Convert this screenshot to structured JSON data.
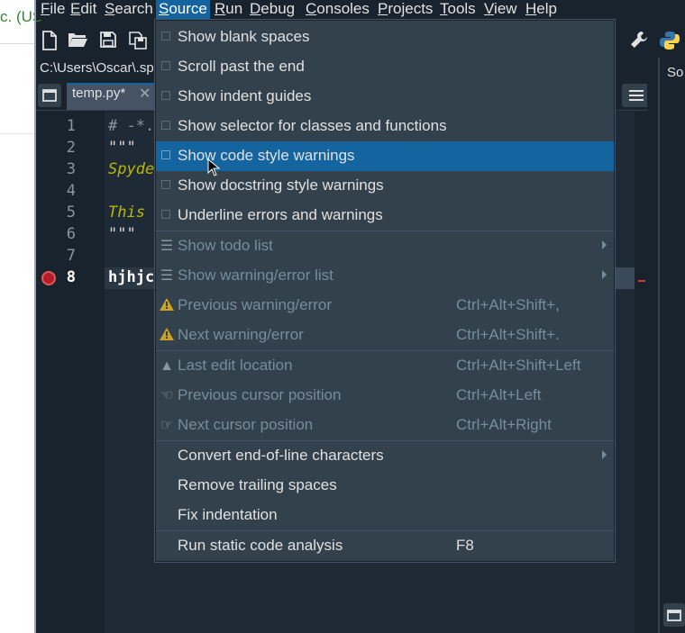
{
  "background_window": {
    "partial_text": "c. (US"
  },
  "menubar": {
    "items": [
      {
        "pre": "",
        "mn": "F",
        "post": "ile"
      },
      {
        "pre": "",
        "mn": "E",
        "post": "dit"
      },
      {
        "pre": "",
        "mn": "S",
        "post": "earch"
      },
      {
        "pre": "",
        "mn": "S",
        "post": "ource"
      },
      {
        "pre": "",
        "mn": "R",
        "post": "un"
      },
      {
        "pre": "",
        "mn": "D",
        "post": "ebug"
      },
      {
        "pre": "",
        "mn": "C",
        "post": "onsoles"
      },
      {
        "pre": "",
        "mn": "P",
        "post": "rojects"
      },
      {
        "pre": "",
        "mn": "T",
        "post": "ools"
      },
      {
        "pre": "",
        "mn": "V",
        "post": "iew"
      },
      {
        "pre": "",
        "mn": "H",
        "post": "elp"
      }
    ],
    "active": "Source"
  },
  "toolbar": {
    "icons": [
      "new-file-icon",
      "open-folder-icon",
      "save-icon",
      "save-all-icon",
      "wrench-icon",
      "python-icon"
    ]
  },
  "path": {
    "text": "C:\\Users\\Oscar\\.sp"
  },
  "tabs": [
    {
      "label": "temp.py*",
      "close": "✕"
    }
  ],
  "editor": {
    "line_numbers": [
      "1",
      "2",
      "3",
      "4",
      "5",
      "6",
      "7",
      "8"
    ],
    "lines": [
      "# -*.",
      "\"\"\"",
      "Spyde",
      "",
      "This",
      "\"\"\"",
      "",
      "hjhjc"
    ],
    "current_line": "8"
  },
  "right_pane": {
    "label": "So"
  },
  "source_menu": {
    "items": [
      {
        "label": "Show blank spaces",
        "type": "check"
      },
      {
        "label": "Scroll past the end",
        "type": "check"
      },
      {
        "label": "Show indent guides",
        "type": "check"
      },
      {
        "label": "Show selector for classes and functions",
        "type": "check"
      },
      {
        "label": "Show code style warnings",
        "type": "check",
        "highlighted": true
      },
      {
        "label": "Show docstring style warnings",
        "type": "check"
      },
      {
        "label": "Underline errors and warnings",
        "type": "check"
      },
      {
        "label": "Show todo list",
        "type": "submenu",
        "disabled": true,
        "icon": "todo-list-icon"
      },
      {
        "label": "Show warning/error list",
        "type": "submenu",
        "disabled": true,
        "icon": "warning-list-icon"
      },
      {
        "label": "Previous warning/error",
        "shortcut": "Ctrl+Alt+Shift+,",
        "disabled": true,
        "icon": "warning-icon"
      },
      {
        "label": "Next warning/error",
        "shortcut": "Ctrl+Alt+Shift+.",
        "disabled": true,
        "icon": "warning-icon"
      },
      {
        "label": "Last edit location",
        "shortcut": "Ctrl+Alt+Shift+Left",
        "disabled": true,
        "icon": "last-edit-icon"
      },
      {
        "label": "Previous cursor position",
        "shortcut": "Ctrl+Alt+Left",
        "disabled": true,
        "icon": "hand-left-icon"
      },
      {
        "label": "Next cursor position",
        "shortcut": "Ctrl+Alt+Right",
        "disabled": true,
        "icon": "hand-right-icon"
      },
      {
        "label": "Convert end-of-line characters",
        "type": "submenu"
      },
      {
        "label": "Remove trailing spaces"
      },
      {
        "label": "Fix indentation"
      },
      {
        "label": "Run static code analysis",
        "shortcut": "F8"
      }
    ]
  }
}
